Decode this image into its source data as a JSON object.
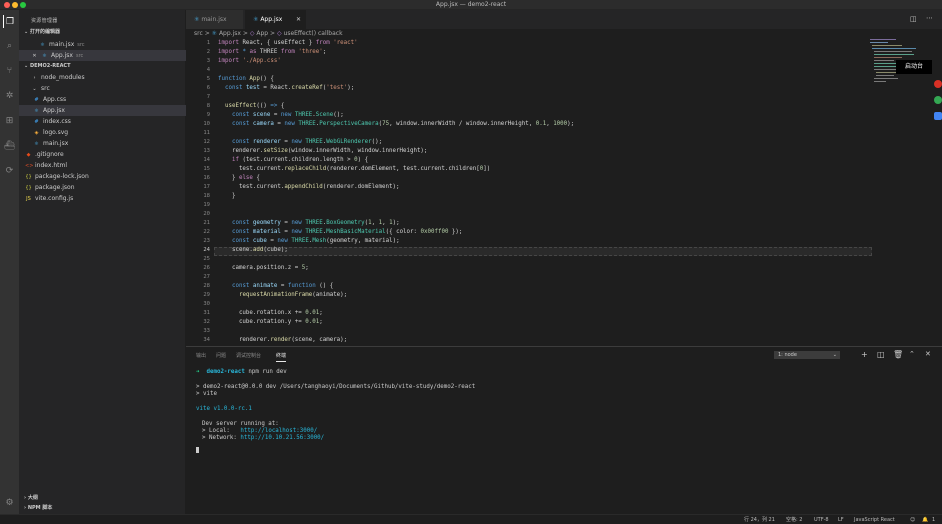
{
  "window": {
    "title": "App.jsx — demo2-react"
  },
  "sidebar": {
    "title": "资源管理器",
    "open_editors_label": "打开的编辑器",
    "open_editors": [
      {
        "name": "main.jsx",
        "desc": "src"
      },
      {
        "name": "App.jsx",
        "desc": "src"
      }
    ],
    "project_label": "DEMO2-REACT",
    "tree": [
      {
        "name": "node_modules",
        "kind": "folder"
      },
      {
        "name": "src",
        "kind": "folder-open"
      },
      {
        "name": "App.css",
        "kind": "css"
      },
      {
        "name": "App.jsx",
        "kind": "jsx"
      },
      {
        "name": "index.css",
        "kind": "css"
      },
      {
        "name": "logo.svg",
        "kind": "svg"
      },
      {
        "name": "main.jsx",
        "kind": "jsx"
      },
      {
        "name": ".gitignore",
        "kind": "git"
      },
      {
        "name": "index.html",
        "kind": "html"
      },
      {
        "name": "package-lock.json",
        "kind": "json"
      },
      {
        "name": "package.json",
        "kind": "json"
      },
      {
        "name": "vite.config.js",
        "kind": "js"
      }
    ],
    "outline_label": "大纲",
    "npm_label": "NPM 脚本"
  },
  "tabs": [
    {
      "label": "main.jsx"
    },
    {
      "label": "App.jsx"
    }
  ],
  "breadcrumb": {
    "part1": "src",
    "sep": ">",
    "part2": "App.jsx",
    "part3": "App",
    "part4": "useEffect() callback"
  },
  "editor": {
    "line_numbers": [
      "1",
      "2",
      "3",
      "4",
      "5",
      "6",
      "7",
      "8",
      "9",
      "10",
      "11",
      "12",
      "13",
      "14",
      "15",
      "16",
      "17",
      "18",
      "19",
      "20",
      "21",
      "22",
      "23",
      "24",
      "25",
      "26",
      "27",
      "28",
      "29",
      "30",
      "31",
      "32",
      "33",
      "34"
    ],
    "current_line": "24"
  },
  "panel": {
    "tabs": [
      "输出",
      "问题",
      "调试控制台",
      "终端"
    ],
    "active_tab": "终端",
    "terminal_select": "1: node",
    "lines": {
      "l1_arrow": "➜",
      "l1_dir": "demo2-react",
      "l1_cmd": "npm run dev",
      "l2": "> demo2-react@0.0.0 dev /Users/tanghaoyi/Documents/Github/vite-study/demo2-react",
      "l3": "> vite",
      "l4": "vite v1.0.0-rc.1",
      "l5": "Dev server running at:",
      "l6_label": "> Local:",
      "l6_url": "http://localhost:3000/",
      "l7_label": "> Network:",
      "l7_url": "http://10.10.21.56:3000/"
    }
  },
  "statusbar": {
    "position": "行 24，列 21",
    "spaces": "空格: 2",
    "encoding": "UTF-8",
    "eol": "LF",
    "language": "JavaScript React",
    "notifications": "1"
  },
  "overlay": {
    "launch_label": "启动台"
  },
  "colors": {
    "keyword": "#569cd6",
    "string": "#ce9178",
    "class": "#4ec9b0",
    "function": "#dcdcaa",
    "variable": "#9cdcfe",
    "number": "#b5cea8"
  }
}
